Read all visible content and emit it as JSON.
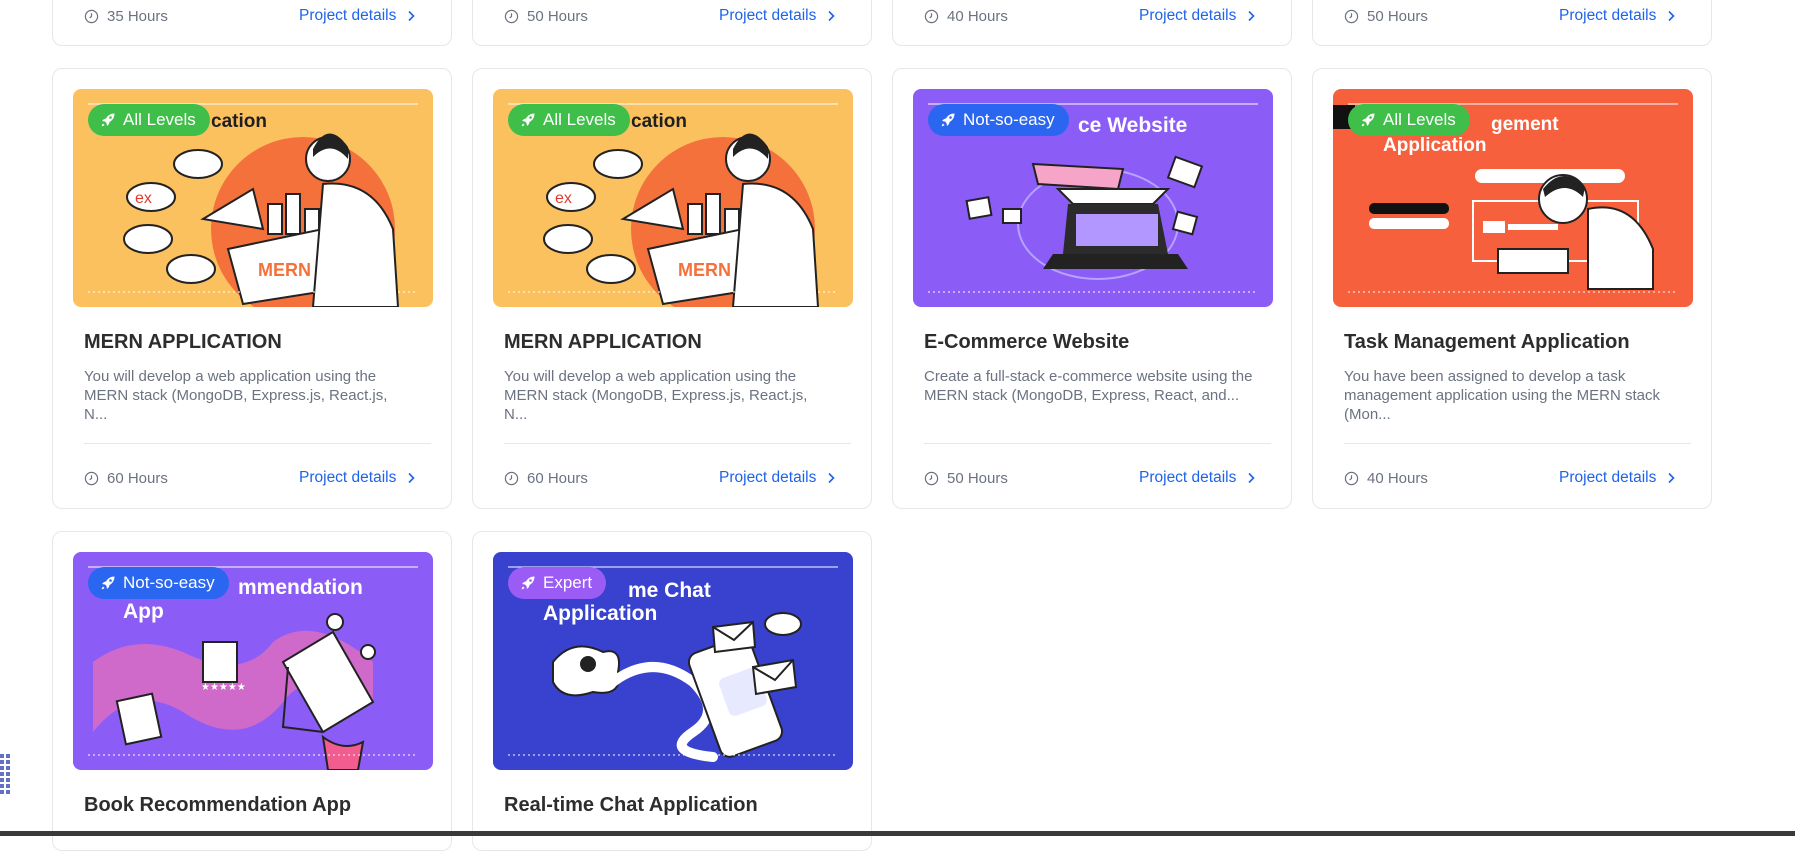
{
  "colors": {
    "accent_link": "#1e63e9",
    "badge_all_levels": "#3fbe49",
    "badge_not_so_easy": "#2a66ef",
    "badge_expert": "#9a5cf5"
  },
  "common": {
    "project_details_label": "Project details"
  },
  "top_row": [
    {
      "hours": "35 Hours"
    },
    {
      "hours": "50 Hours"
    },
    {
      "hours": "40 Hours"
    },
    {
      "hours": "50 Hours"
    }
  ],
  "cards": [
    {
      "level": "All Levels",
      "image_caption": "cation",
      "title": "MERN APPLICATION",
      "description": "You will develop a web application using the MERN stack (MongoDB, Express.js, React.js, N...",
      "hours": "60 Hours"
    },
    {
      "level": "All Levels",
      "image_caption": "cation",
      "title": "MERN APPLICATION",
      "description": "You will develop a web application using the MERN stack (MongoDB, Express.js, React.js, N...",
      "hours": "60 Hours"
    },
    {
      "level": "Not-so-easy",
      "image_caption": "ce Website",
      "title": "E-Commerce Website",
      "description": "Create a full-stack e-commerce website using the MERN stack (MongoDB, Express, React, and...",
      "hours": "50 Hours"
    },
    {
      "level": "All Levels",
      "image_caption": "gement",
      "image_caption_2": "Application",
      "title": "Task Management Application",
      "description": "You have been assigned to develop a task management application using the MERN stack (Mon...",
      "hours": "40 Hours"
    },
    {
      "level": "Not-so-easy",
      "image_caption": "mmendation",
      "image_caption_2": "App",
      "title": "Book Recommendation App"
    },
    {
      "level": "Expert",
      "image_caption": "me Chat",
      "image_caption_2": "Application",
      "title": "Real-time Chat Application"
    }
  ],
  "icons": {
    "badge": "rocket-icon",
    "hours": "clock-icon",
    "details": "chevron-right-icon",
    "side": "grid-dots-icon"
  }
}
